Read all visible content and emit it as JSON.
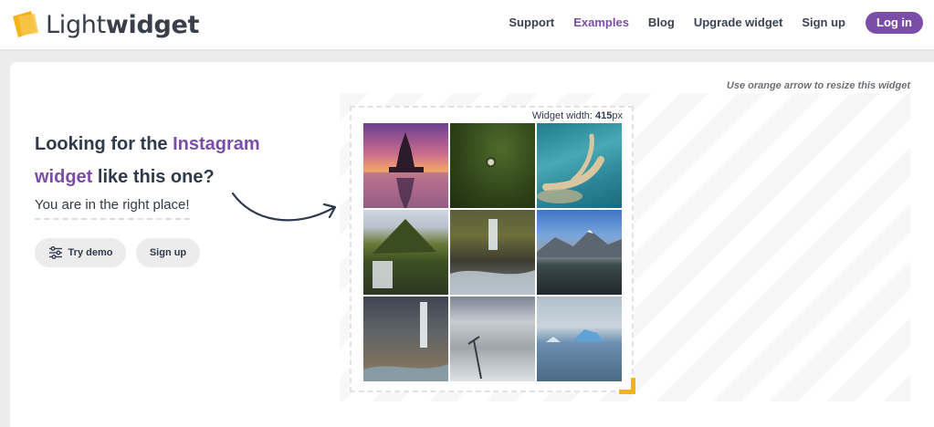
{
  "header": {
    "logo": {
      "light": "Light",
      "bold": "widget"
    },
    "nav": [
      {
        "label": "Support",
        "active": false
      },
      {
        "label": "Examples",
        "active": true
      },
      {
        "label": "Blog",
        "active": false
      },
      {
        "label": "Upgrade widget",
        "active": false
      },
      {
        "label": "Sign up",
        "active": false
      }
    ],
    "login_label": "Log in"
  },
  "hero": {
    "headline_part1": "Looking for the ",
    "headline_accent1": "Instagram",
    "headline_accent2": "widget",
    "headline_part2": " like this one?",
    "subline": "You are in the right place!",
    "try_demo_label": "Try demo",
    "signup_label": "Sign up"
  },
  "widget": {
    "resize_hint": "Use orange arrow to resize this widget",
    "width_label_prefix": "Widget width: ",
    "width_value": "415",
    "width_unit": "px",
    "photos": [
      {
        "name": "temple-sunset"
      },
      {
        "name": "green-field-aerial"
      },
      {
        "name": "coastal-road-aerial"
      },
      {
        "name": "mountain-waterfall"
      },
      {
        "name": "river-waterfall"
      },
      {
        "name": "mountains-lake"
      },
      {
        "name": "basalt-waterfall"
      },
      {
        "name": "glacier-ice"
      },
      {
        "name": "iceberg-lagoon"
      }
    ]
  },
  "colors": {
    "accent": "#7a4ea8",
    "handle": "#f5b21b",
    "text": "#2f3a4b"
  },
  "icons": {
    "logo": "lightwidget-logo-icon",
    "demo": "sliders-icon",
    "arrow": "curved-arrow-icon",
    "resize": "resize-corner-icon"
  }
}
